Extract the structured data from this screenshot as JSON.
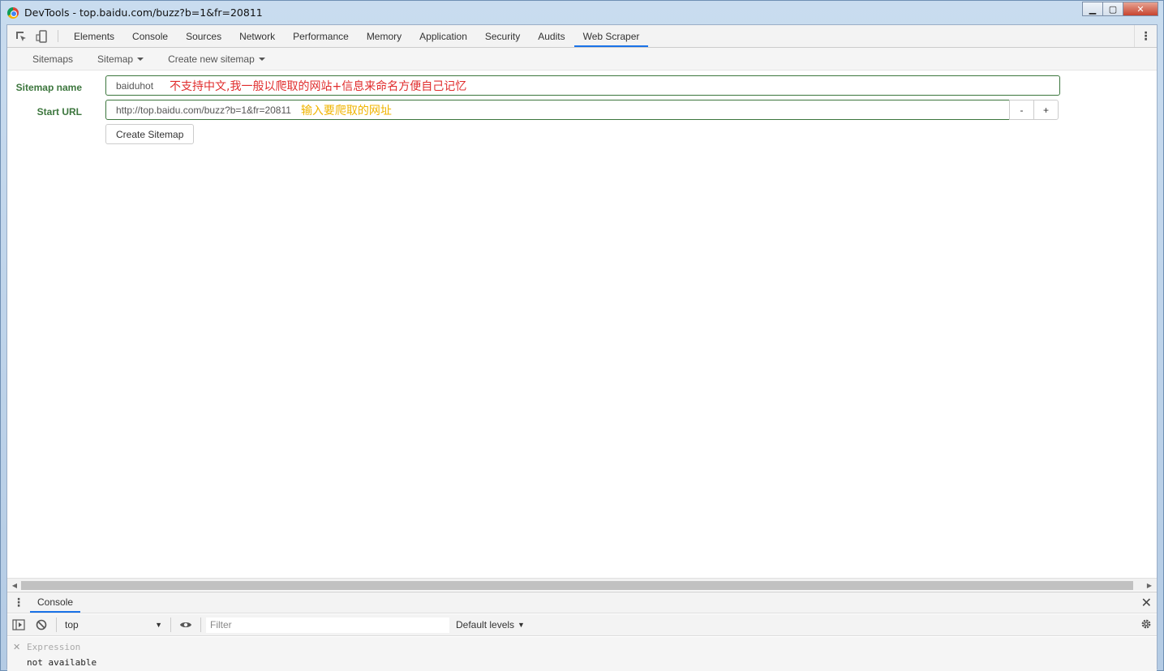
{
  "window": {
    "title": "DevTools - top.baidu.com/buzz?b=1&fr=20811",
    "minimize": "▁",
    "maximize": "▢",
    "close": "✕"
  },
  "devtools_tabs": [
    "Elements",
    "Console",
    "Sources",
    "Network",
    "Performance",
    "Memory",
    "Application",
    "Security",
    "Audits",
    "Web Scraper"
  ],
  "active_tab": "Web Scraper",
  "subnav": {
    "sitemaps": "Sitemaps",
    "sitemap": "Sitemap",
    "create_new": "Create new sitemap"
  },
  "form": {
    "sitemap_name_label": "Sitemap name",
    "sitemap_name_value": "baiduhot",
    "sitemap_name_note": "不支持中文,我一般以爬取的网站+信息来命名方便自己记忆",
    "start_url_label": "Start URL",
    "start_url_value": "http://top.baidu.com/buzz?b=1&fr=20811",
    "start_url_note": "输入要爬取的网址",
    "minus": "-",
    "plus": "+",
    "create_button": "Create Sitemap"
  },
  "drawer": {
    "tab": "Console",
    "context": "top",
    "filter_placeholder": "Filter",
    "levels": "Default levels",
    "expression_label": "Expression",
    "expression_value": "not available"
  },
  "colors": {
    "label_green": "#3c763d",
    "annotation_red": "#e02c2c",
    "annotation_yellow": "#f0b400",
    "active_tab_underline": "#1a73e8"
  }
}
